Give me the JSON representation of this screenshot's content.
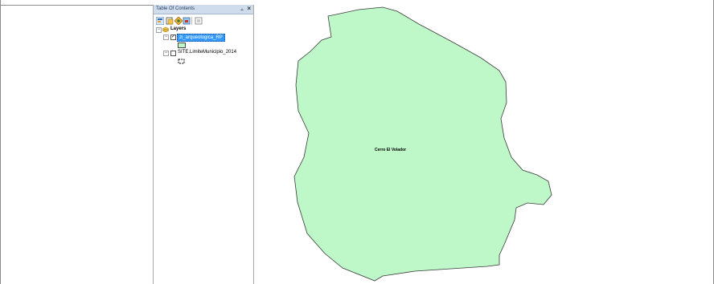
{
  "toc": {
    "title": "Table Of Contents",
    "pin_icon": "pin-icon",
    "close_label": "×",
    "toolbar": [
      "list-by-drawing-order-icon",
      "list-by-source-icon",
      "list-by-visibility-icon",
      "list-by-selection-icon",
      "options-icon"
    ],
    "tree": {
      "root_label": "Layers",
      "layers": [
        {
          "name": "zi_arqueologica_RP",
          "checked": true,
          "selected": true,
          "symbol_color": "#bef7c8"
        },
        {
          "name": "SITE.LimiteMunicipio_2014",
          "checked": false,
          "selected": false
        }
      ]
    }
  },
  "map": {
    "polygon_fill": "#bef7c8",
    "polygon_stroke": "#3a3a3a",
    "feature_label": "Cerro El Volador"
  },
  "colors": {
    "toc_header": "#cfdcec",
    "selection": "#3399ff"
  }
}
